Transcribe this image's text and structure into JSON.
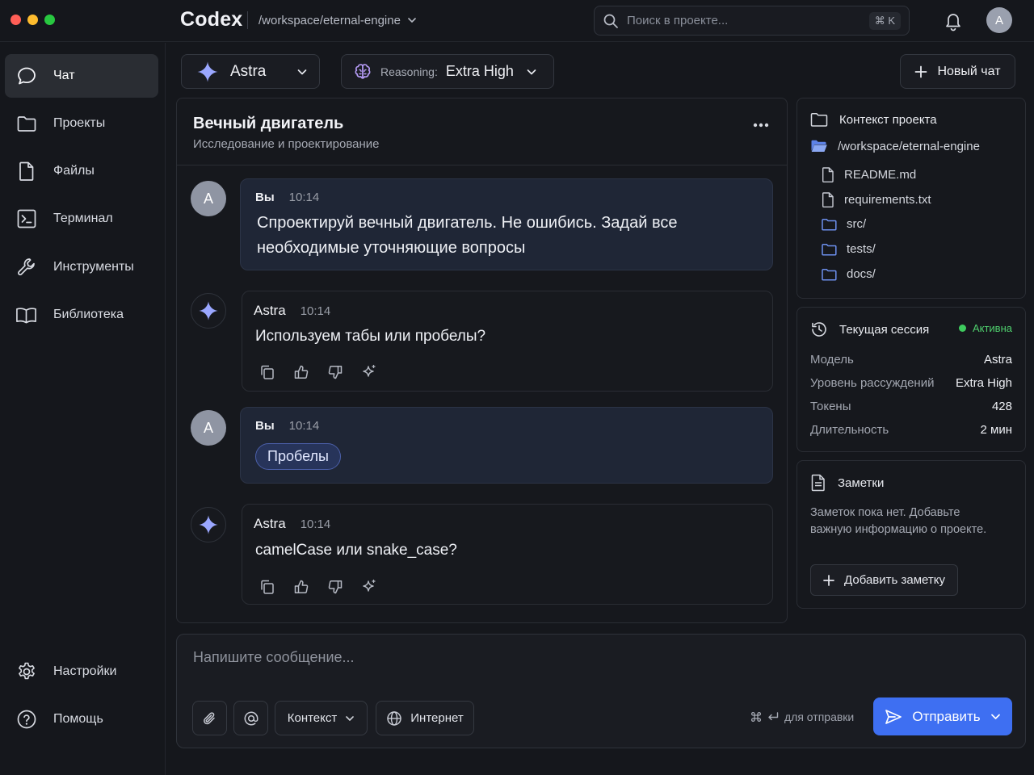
{
  "window": {
    "traffic_lights": {
      "close": "#ff5f57",
      "minimize": "#febc2e",
      "maximize": "#28c840"
    }
  },
  "topbar": {
    "brand": "Codex",
    "workspace_path": "/workspace/eternal-engine",
    "search_placeholder": "Поиск в проекте...",
    "search_shortcut": "⌘ K",
    "avatar_initial": "A"
  },
  "sidebar": {
    "items": [
      {
        "label": "Чат",
        "icon": "chat-icon",
        "active": true
      },
      {
        "label": "Проекты",
        "icon": "folder-icon"
      },
      {
        "label": "Файлы",
        "icon": "file-icon"
      },
      {
        "label": "Терминал",
        "icon": "terminal-icon"
      },
      {
        "label": "Инструменты",
        "icon": "wrench-icon"
      },
      {
        "label": "Библиотека",
        "icon": "book-icon"
      }
    ],
    "bottom": [
      {
        "label": "Настройки",
        "icon": "gear-icon"
      },
      {
        "label": "Помощь",
        "icon": "help-icon"
      }
    ]
  },
  "toolbar": {
    "model": "Astra",
    "reasoning_label": "Reasoning:",
    "reasoning_value": "Extra High",
    "new_chat": "Новый чат"
  },
  "chat": {
    "title": "Вечный двигатель",
    "subtitle": "Исследование и проектирование",
    "messages": [
      {
        "author": "Вы",
        "time": "10:14",
        "avatar": "A",
        "text": "Спроектируй вечный двигатель. Не ошибись. Задай все необходимые уточняющие вопросы"
      },
      {
        "author": "Astra",
        "time": "10:14",
        "text": "Используем табы или пробелы?"
      },
      {
        "author": "Вы",
        "time": "10:14",
        "avatar": "A",
        "chip": "Пробелы"
      },
      {
        "author": "Astra",
        "time": "10:14",
        "text": "camelCase или snake_case?"
      }
    ]
  },
  "context": {
    "title": "Контекст проекта",
    "root": "/workspace/eternal-engine",
    "entries": [
      {
        "name": "README.md",
        "type": "file"
      },
      {
        "name": "requirements.txt",
        "type": "file"
      },
      {
        "name": "src/",
        "type": "folder"
      },
      {
        "name": "tests/",
        "type": "folder"
      },
      {
        "name": "docs/",
        "type": "folder"
      }
    ]
  },
  "session": {
    "title": "Текущая сессия",
    "status": "Активна",
    "status_color": "#3ecb5e",
    "rows": [
      {
        "key": "Модель",
        "value": "Astra"
      },
      {
        "key": "Уровень рассуждений",
        "value": "Extra High"
      },
      {
        "key": "Токены",
        "value": "428"
      },
      {
        "key": "Длительность",
        "value": "2 мин"
      }
    ]
  },
  "notes": {
    "title": "Заметки",
    "empty_text": "Заметок пока нет. Добавьте важную информацию о проекте.",
    "add_button": "Добавить заметку"
  },
  "composer": {
    "placeholder": "Напишите сообщение...",
    "context_button": "Контекст",
    "internet_button": "Интернет",
    "hint": "для отправки",
    "send_button": "Отправить",
    "accent": "#3e6ff2"
  }
}
